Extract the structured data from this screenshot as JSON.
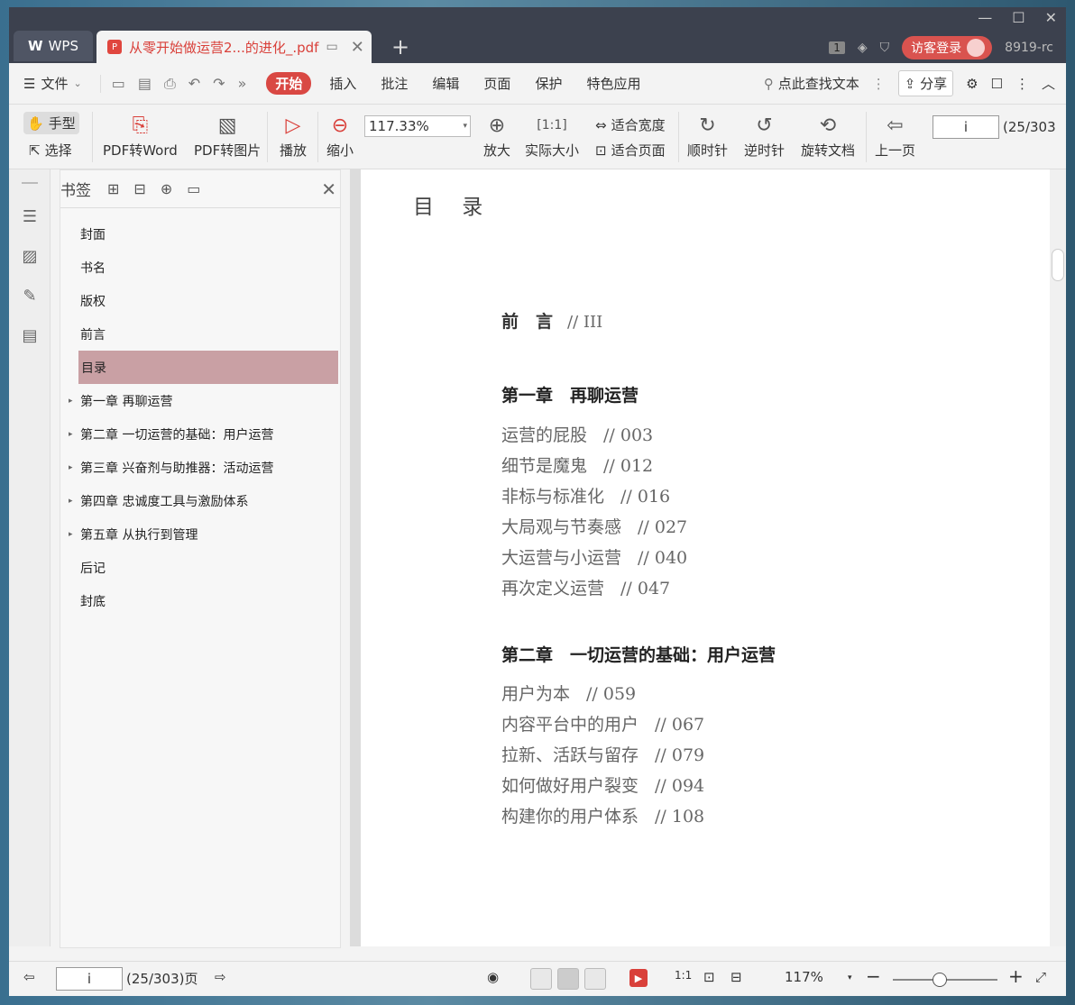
{
  "titlebar": {
    "app_tab": "WPS",
    "doc_tab": "从零开始做运营2...的进化_.pdf",
    "badge_number": "1",
    "login_label": "访客登录",
    "user_id": "8919-rc"
  },
  "menubar": {
    "file": "文件",
    "items": [
      "开始",
      "插入",
      "批注",
      "编辑",
      "页面",
      "保护",
      "特色应用"
    ],
    "active": "开始",
    "search": "点此查找文本",
    "share": "分享"
  },
  "toolbar": {
    "hand": "手型",
    "select": "选择",
    "pdf_to_word": "PDF转Word",
    "pdf_to_image": "PDF转图片",
    "play": "播放",
    "zoom_out": "缩小",
    "zoom_value": "117.33%",
    "zoom_in": "放大",
    "actual_size": "实际大小",
    "fit_width": "适合宽度",
    "fit_page": "适合页面",
    "rotate_cw": "顺时针",
    "rotate_ccw": "逆时针",
    "rotate_doc": "旋转文档",
    "prev_page": "上一页",
    "page_input": "i",
    "page_count": "(25/303"
  },
  "bookmarks": {
    "title": "书签",
    "items": [
      {
        "label": "封面",
        "expandable": false
      },
      {
        "label": "书名",
        "expandable": false
      },
      {
        "label": "版权",
        "expandable": false
      },
      {
        "label": "前言",
        "expandable": false
      },
      {
        "label": "目录",
        "expandable": false
      },
      {
        "label": "第一章 再聊运营",
        "expandable": true
      },
      {
        "label": "第二章 一切运营的基础：用户运营",
        "expandable": true
      },
      {
        "label": "第三章 兴奋剂与助推器：活动运营",
        "expandable": true
      },
      {
        "label": "第四章 忠诚度工具与激励体系",
        "expandable": true
      },
      {
        "label": "第五章 从执行到管理",
        "expandable": true
      },
      {
        "label": "后记",
        "expandable": false
      },
      {
        "label": "封底",
        "expandable": false
      }
    ],
    "selected": "目录"
  },
  "document": {
    "toc_title": "目 录",
    "preface": {
      "label": "前　言",
      "page": "// III"
    },
    "chapter1": {
      "title": "第一章　再聊运营",
      "entries": [
        {
          "label": "运营的屁股",
          "page": "// 003"
        },
        {
          "label": "细节是魔鬼",
          "page": "// 012"
        },
        {
          "label": "非标与标准化",
          "page": "// 016"
        },
        {
          "label": "大局观与节奏感",
          "page": "// 027"
        },
        {
          "label": "大运营与小运营",
          "page": "// 040"
        },
        {
          "label": "再次定义运营",
          "page": "// 047"
        }
      ]
    },
    "chapter2": {
      "title": "第二章　一切运营的基础：用户运营",
      "entries": [
        {
          "label": "用户为本",
          "page": "// 059"
        },
        {
          "label": "内容平台中的用户",
          "page": "// 067"
        },
        {
          "label": "拉新、活跃与留存",
          "page": "// 079"
        },
        {
          "label": "如何做好用户裂变",
          "page": "// 094"
        },
        {
          "label": "构建你的用户体系",
          "page": "// 108"
        }
      ]
    }
  },
  "statusbar": {
    "page_input": "i",
    "page_info": "(25/303)页",
    "zoom": "117%",
    "zoom_slider_fraction": 0.45
  }
}
